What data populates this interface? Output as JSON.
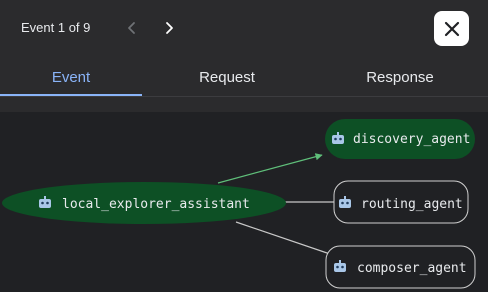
{
  "header": {
    "event_counter": "Event 1 of 9",
    "prev_icon": "chevron-left-icon",
    "next_icon": "chevron-right-icon",
    "close_icon": "close-icon"
  },
  "tabs": [
    {
      "label": "Event",
      "active": true
    },
    {
      "label": "Request",
      "active": false
    },
    {
      "label": "Response",
      "active": false
    }
  ],
  "graph": {
    "nodes": [
      {
        "id": "local_explorer_assistant",
        "label": "local_explorer_assistant",
        "icon": "robot-icon",
        "highlighted": true
      },
      {
        "id": "discovery_agent",
        "label": "discovery_agent",
        "icon": "robot-icon",
        "highlighted": true
      },
      {
        "id": "routing_agent",
        "label": "routing_agent",
        "icon": "robot-icon",
        "highlighted": false
      },
      {
        "id": "composer_agent",
        "label": "composer_agent",
        "icon": "robot-icon",
        "highlighted": false
      }
    ],
    "edges": [
      {
        "from": "local_explorer_assistant",
        "to": "discovery_agent",
        "highlighted": true
      },
      {
        "from": "local_explorer_assistant",
        "to": "routing_agent",
        "highlighted": false
      },
      {
        "from": "local_explorer_assistant",
        "to": "composer_agent",
        "highlighted": false
      }
    ]
  },
  "colors": {
    "accent_tab": "#8ab4f8",
    "node_highlight_fill": "#0d5025",
    "edge_highlight": "#5fbf7a",
    "edge_default": "#c8c8c8",
    "background": "#2b2b2d",
    "canvas": "#202124"
  }
}
